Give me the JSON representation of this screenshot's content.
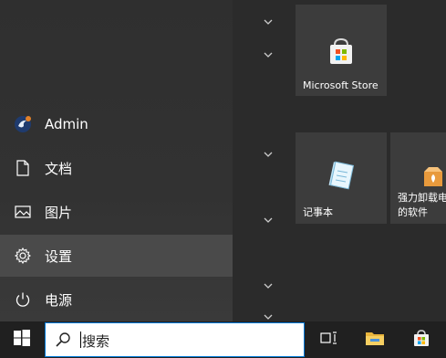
{
  "left_rail": {
    "items": [
      {
        "label": "Admin",
        "icon": "user-avatar-icon"
      },
      {
        "label": "文档",
        "icon": "document-icon"
      },
      {
        "label": "图片",
        "icon": "pictures-icon"
      },
      {
        "label": "设置",
        "icon": "gear-icon"
      },
      {
        "label": "电源",
        "icon": "power-icon"
      }
    ]
  },
  "tiles": [
    {
      "label": "Microsoft Store",
      "icon": "store-bag-icon"
    },
    {
      "label": "记事本",
      "icon": "notepad-icon"
    },
    {
      "label_line1": "强力卸载电",
      "label_line2": "的软件",
      "icon": "uninstaller-box-icon"
    }
  ],
  "taskbar": {
    "search_placeholder": "搜索",
    "buttons": [
      "start-icon",
      "task-view-icon",
      "file-explorer-icon",
      "store-icon"
    ]
  },
  "colors": {
    "accent": "#0078d7",
    "tile_bg": "#3c3c3c",
    "taskbar_bg": "#202020"
  }
}
